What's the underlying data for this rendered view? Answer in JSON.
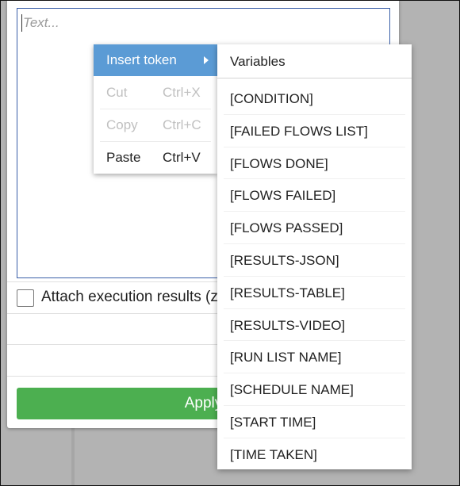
{
  "editor": {
    "placeholder": "Text...",
    "attach_label": "Attach execution results (zip)",
    "apply_label": "Apply"
  },
  "context_menu": {
    "items": [
      {
        "label": "Insert token",
        "shortcut": "",
        "state": "highlighted"
      },
      {
        "label": "Cut",
        "shortcut": "Ctrl+X",
        "state": "disabled"
      },
      {
        "label": "Copy",
        "shortcut": "Ctrl+C",
        "state": "disabled"
      },
      {
        "label": "Paste",
        "shortcut": "Ctrl+V",
        "state": "enabled"
      }
    ]
  },
  "submenu": {
    "header": "Variables",
    "tokens": [
      "[CONDITION]",
      "[FAILED FLOWS LIST]",
      "[FLOWS DONE]",
      "[FLOWS FAILED]",
      "[FLOWS PASSED]",
      "[RESULTS-JSON]",
      "[RESULTS-TABLE]",
      "[RESULTS-VIDEO]",
      "[RUN LIST NAME]",
      "[SCHEDULE NAME]",
      "[START TIME]",
      "[TIME TAKEN]"
    ]
  },
  "colors": {
    "apply_button": "#4caf50",
    "highlight": "#5b9bd5",
    "textarea_border": "#3a5fa8"
  }
}
